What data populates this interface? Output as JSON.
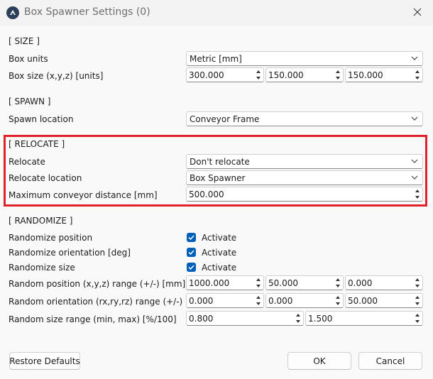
{
  "window": {
    "title": "Box Spawner Settings (0)"
  },
  "size": {
    "header": "[ SIZE ]",
    "units_label": "Box units",
    "units_value": "Metric [mm]",
    "box_size_label": "Box size (x,y,z) [units]",
    "box_size": [
      "300.000",
      "150.000",
      "150.000"
    ]
  },
  "spawn": {
    "header": "[ SPAWN ]",
    "location_label": "Spawn location",
    "location_value": "Conveyor Frame"
  },
  "relocate": {
    "header": "[ RELOCATE ]",
    "relocate_label": "Relocate",
    "relocate_value": "Don't relocate",
    "location_label": "Relocate location",
    "location_value": "Box Spawner",
    "max_distance_label": "Maximum conveyor distance [mm]",
    "max_distance_value": "500.000",
    "highlight_color": "#e0212a"
  },
  "randomize": {
    "header": "[ RANDOMIZE ]",
    "position_label": "Randomize position",
    "orientation_label": "Randomize orientation [deg]",
    "size_label": "Randomize size",
    "activate_label": "Activate",
    "position_range_label": "Random position (x,y,z) range (+/-) [mm]",
    "position_range": [
      "1000.000",
      "50.000",
      "0.000"
    ],
    "orientation_range_label": "Random orientation (rx,ry,rz) range (+/-)",
    "orientation_range": [
      "0.000",
      "0.000",
      "50.000"
    ],
    "size_range_label": "Random size range (min, max) [%/100]",
    "size_range": [
      "0.800",
      "1.500"
    ]
  },
  "buttons": {
    "restore": "Restore Defaults",
    "ok": "OK",
    "cancel": "Cancel"
  },
  "colors": {
    "accent": "#005fb8"
  }
}
